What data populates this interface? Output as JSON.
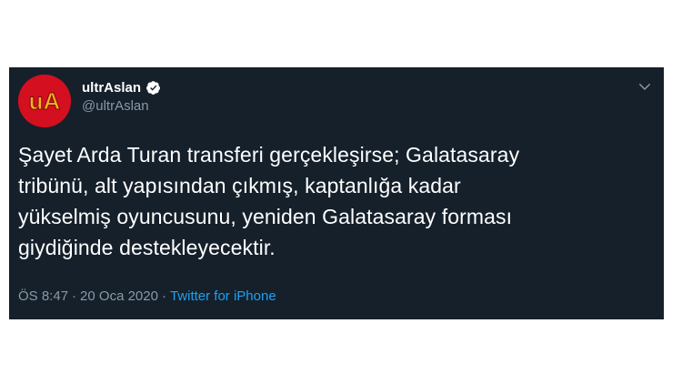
{
  "tweet": {
    "avatar_text": "uA",
    "display_name": "ultrAslan",
    "handle": "@ultrAslan",
    "verified_icon": "verified-badge-icon",
    "menu_icon": "chevron-down-icon",
    "text": "Şayet Arda Turan transferi gerçekleşirse; Galatasaray\ntribünü, alt yapısından çıkmış, kaptanlığa kadar\nyükselmiş oyuncusunu, yeniden Galatasaray forması\ngiydiğinde destekleyecektir.",
    "time": "ÖS 8:47",
    "separator1": "·",
    "date": "20 Oca 2020",
    "separator2": "·",
    "source": "Twitter for iPhone"
  },
  "colors": {
    "background": "#15202b",
    "text": "#ffffff",
    "muted": "#8899a6",
    "link": "#1da1f2",
    "avatar_red": "#d40f1f",
    "avatar_yellow": "#f6b21a"
  }
}
